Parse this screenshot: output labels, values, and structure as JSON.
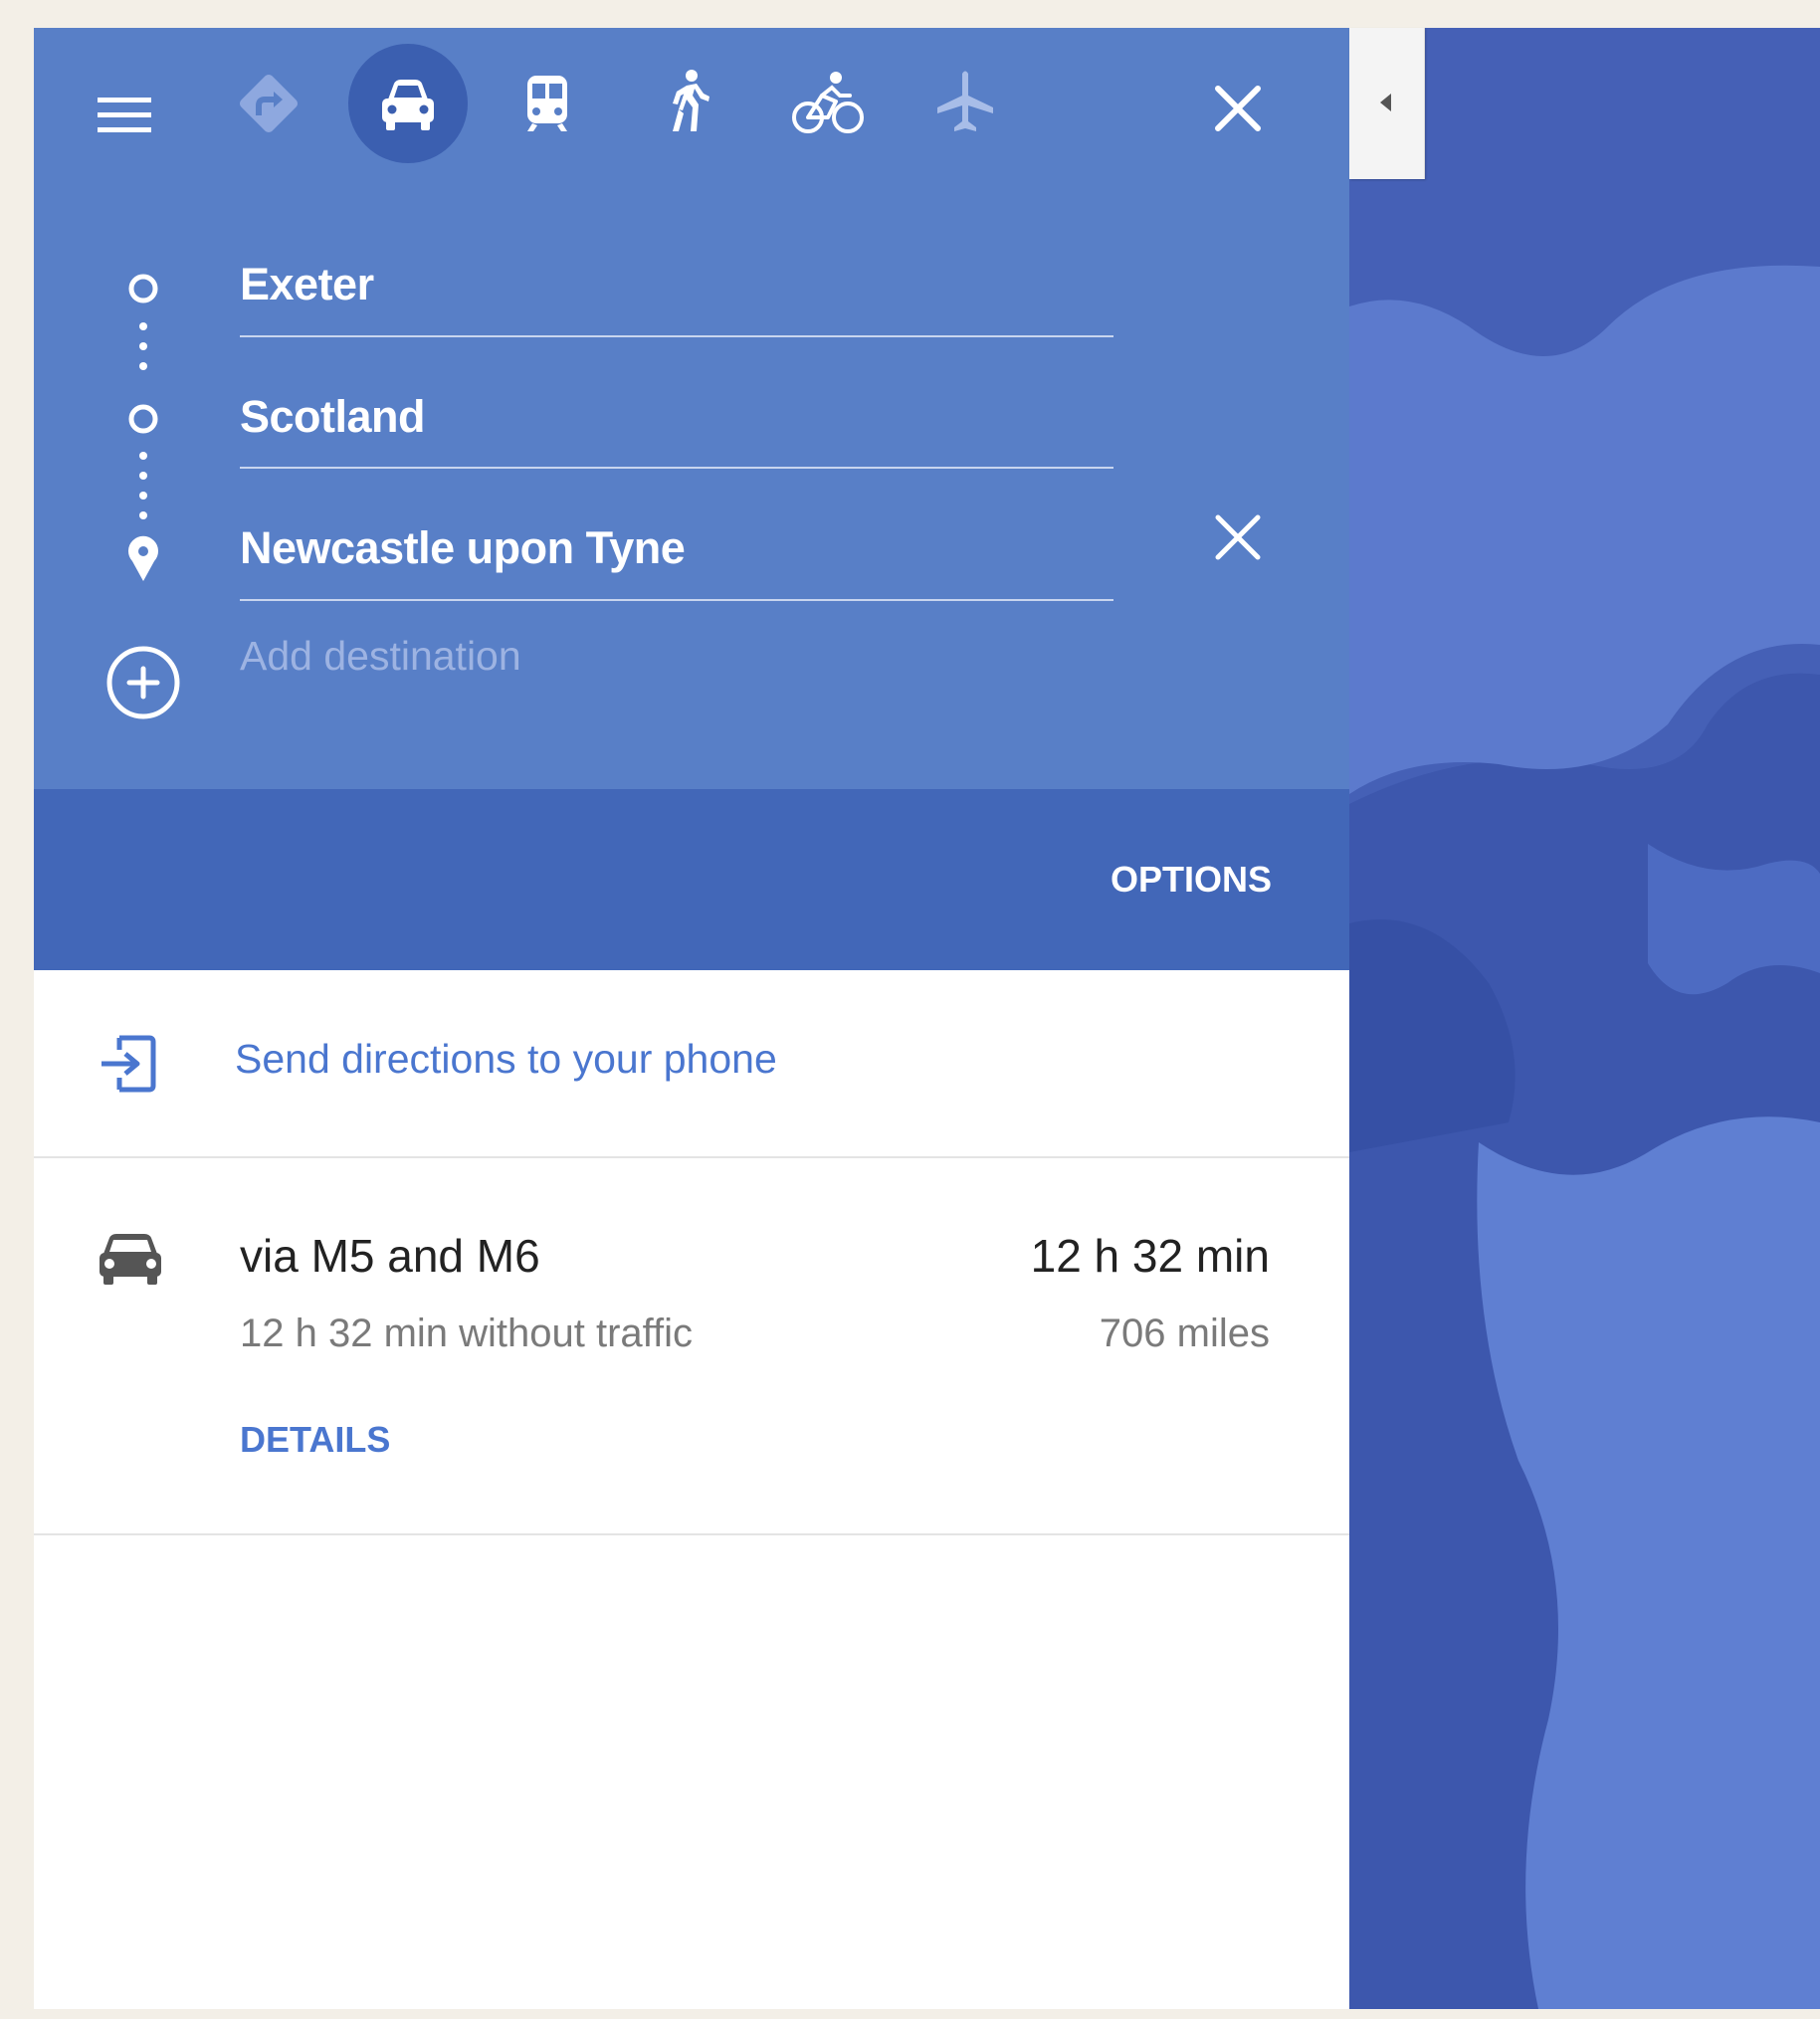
{
  "travel_modes": {
    "items": [
      {
        "id": "best",
        "icon": "directions-diamond-icon",
        "label": "Best travel modes"
      },
      {
        "id": "driving",
        "icon": "car-icon",
        "label": "Driving",
        "selected": true
      },
      {
        "id": "transit",
        "icon": "train-icon",
        "label": "Transit"
      },
      {
        "id": "walking",
        "icon": "walking-icon",
        "label": "Walking"
      },
      {
        "id": "cycling",
        "icon": "bicycle-icon",
        "label": "Cycling"
      },
      {
        "id": "flights",
        "icon": "airplane-icon",
        "label": "Flights"
      }
    ]
  },
  "route_inputs": {
    "stops": [
      {
        "value": "Exeter",
        "icon": "waypoint-circle-icon"
      },
      {
        "value": "Scotland",
        "icon": "waypoint-circle-icon"
      },
      {
        "value": "Newcastle upon Tyne",
        "icon": "destination-pin-icon"
      }
    ],
    "add_destination_placeholder": "Add destination"
  },
  "options": {
    "label": "OPTIONS"
  },
  "send_to_phone": {
    "label": "Send directions to your phone",
    "icon": "send-to-device-icon"
  },
  "route": {
    "icon": "car-icon",
    "name": "via M5 and M6",
    "duration": "12 h 32 min",
    "without_traffic": "12 h 32 min without traffic",
    "distance": "706 miles",
    "details_label": "DETAILS"
  },
  "colors": {
    "header": "#587fc7",
    "options_bar": "#4267b8",
    "selected_mode": "#3b5fb0",
    "link": "#4a76cf",
    "map": "#4a68bf"
  }
}
